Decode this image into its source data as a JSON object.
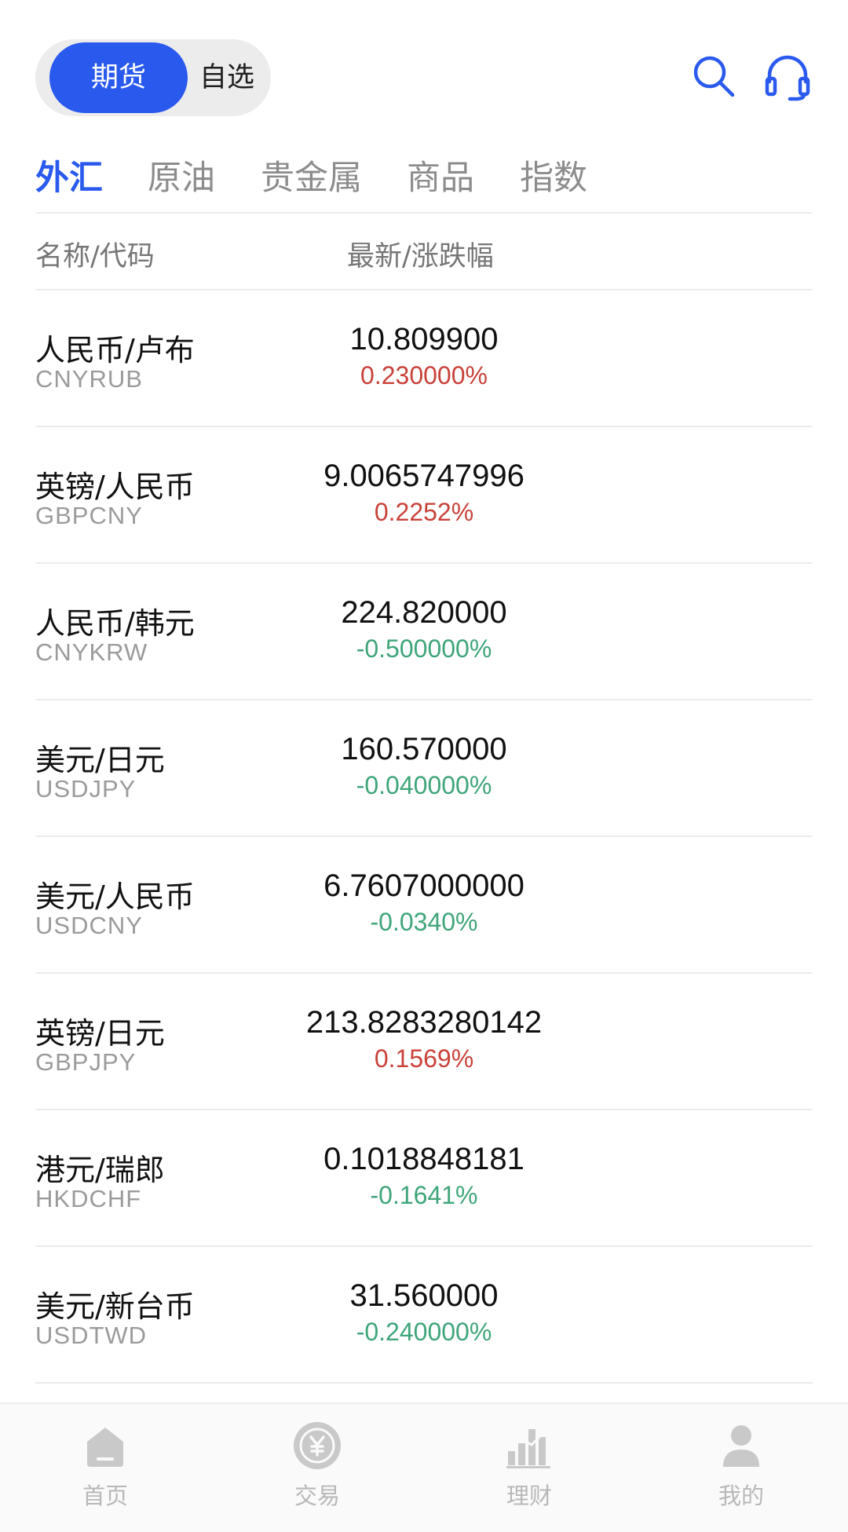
{
  "header": {
    "segments": [
      {
        "label": "期货",
        "active": true
      },
      {
        "label": "自选",
        "active": false
      }
    ],
    "icons": {
      "search": "search-icon",
      "support": "headset-icon"
    },
    "accent_color": "#2a59ee"
  },
  "tabs": [
    {
      "label": "外汇",
      "active": true
    },
    {
      "label": "原油",
      "active": false
    },
    {
      "label": "贵金属",
      "active": false
    },
    {
      "label": "商品",
      "active": false
    },
    {
      "label": "指数",
      "active": false
    }
  ],
  "columns": {
    "name": "名称/代码",
    "price": "最新/涨跌幅"
  },
  "colors": {
    "up": "#c9423a",
    "down": "#3fa57a"
  },
  "rows": [
    {
      "name": "人民币/卢布",
      "code": "CNYRUB",
      "price": "10.809900",
      "change": "0.230000%",
      "direction": "up"
    },
    {
      "name": "英镑/人民币",
      "code": "GBPCNY",
      "price": "9.0065747996",
      "change": "0.2252%",
      "direction": "up"
    },
    {
      "name": "人民币/韩元",
      "code": "CNYKRW",
      "price": "224.820000",
      "change": "-0.500000%",
      "direction": "down"
    },
    {
      "name": "美元/日元",
      "code": "USDJPY",
      "price": "160.570000",
      "change": "-0.040000%",
      "direction": "down"
    },
    {
      "name": "美元/人民币",
      "code": "USDCNY",
      "price": "6.7607000000",
      "change": "-0.0340%",
      "direction": "down"
    },
    {
      "name": "英镑/日元",
      "code": "GBPJPY",
      "price": "213.8283280142",
      "change": "0.1569%",
      "direction": "up"
    },
    {
      "name": "港元/瑞郎",
      "code": "HKDCHF",
      "price": "0.1018848181",
      "change": "-0.1641%",
      "direction": "down"
    },
    {
      "name": "美元/新台币",
      "code": "USDTWD",
      "price": "31.560000",
      "change": "-0.240000%",
      "direction": "down"
    }
  ],
  "bottom_nav": [
    {
      "label": "首页",
      "icon": "home-icon"
    },
    {
      "label": "交易",
      "icon": "yuan-coin-icon"
    },
    {
      "label": "理财",
      "icon": "chart-bars-icon"
    },
    {
      "label": "我的",
      "icon": "user-icon"
    }
  ]
}
